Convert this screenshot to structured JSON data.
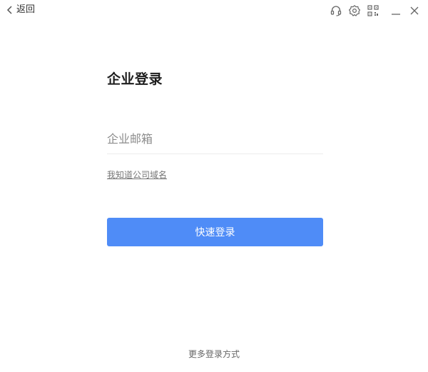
{
  "titlebar": {
    "back_label": "返回",
    "icons": [
      "headset-icon",
      "gear-icon",
      "qr-code-icon",
      "minimize-icon",
      "close-icon"
    ]
  },
  "login": {
    "heading": "企业登录",
    "email_placeholder": "企业邮箱",
    "email_value": "",
    "domain_link": "我知道公司域名",
    "submit_label": "快速登录",
    "more_options": "更多登录方式"
  },
  "colors": {
    "primary": "#4f8cf7",
    "icon": "#666666",
    "divider": "#ececec"
  }
}
